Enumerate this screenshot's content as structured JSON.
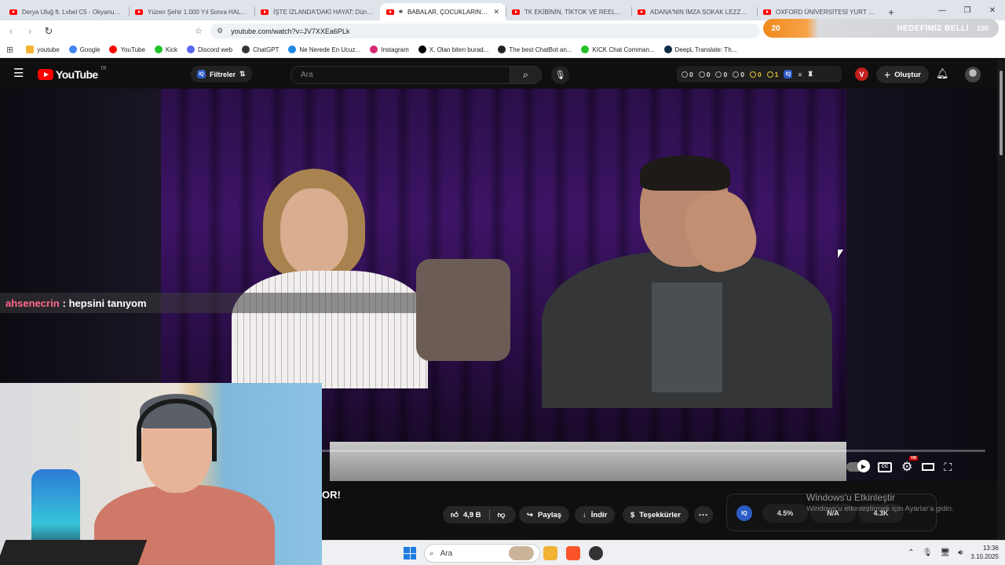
{
  "browser": {
    "tabs": [
      {
        "title": "Derya Uluğ ft. Lvbel C5 - Okyanus X",
        "active": false
      },
      {
        "title": "Yüzen Şehir 1.000 Yıl Sonra HALA N",
        "active": false
      },
      {
        "title": "İŞTE İZLANDA'DAKİ HAYAT: Dünyan",
        "active": false
      },
      {
        "title": "BABALAR, ÇOCUKLARININ T",
        "active": true
      },
      {
        "title": "TK EKİBİNİN, TİKTOK VE REELS VİDEO",
        "active": false
      },
      {
        "title": "ADANA'NIN İMZA SOKAK LEZZETLER",
        "active": false
      },
      {
        "title": "OXFORD ÜNİVERSİTESİ YURT ODASI",
        "active": false
      }
    ],
    "url": "youtube.com/watch?v=JV7XXEa6PLk",
    "promo": {
      "left_num": "20",
      "title": "HEDEFİMİZ BELLİ",
      "right_num": "100"
    },
    "bookmarks": [
      {
        "label": "youtube",
        "icon": "folder-icon",
        "color": "#f2b233"
      },
      {
        "label": "Google",
        "icon": "google-icon",
        "color": "#4285f4"
      },
      {
        "label": "YouTube",
        "icon": "youtube-icon",
        "color": "#ff0000"
      },
      {
        "label": "Kick",
        "icon": "kick-icon",
        "color": "#23c22a"
      },
      {
        "label": "Discord web",
        "icon": "discord-icon",
        "color": "#5865f2"
      },
      {
        "label": "ChatGPT",
        "icon": "chatgpt-icon",
        "color": "#333333"
      },
      {
        "label": "Ne Nerede En Ucuz...",
        "icon": "check-icon",
        "color": "#1e88e5"
      },
      {
        "label": "Instagram",
        "icon": "instagram-icon",
        "color": "#d62976"
      },
      {
        "label": "X. Olan biten burad...",
        "icon": "x-icon",
        "color": "#000000"
      },
      {
        "label": "The best ChatBot an...",
        "icon": "github-icon",
        "color": "#222222"
      },
      {
        "label": "KICK Chat Comman...",
        "icon": "kick-icon",
        "color": "#23c22a"
      },
      {
        "label": "DeepL Translate: Th...",
        "icon": "deepl-icon",
        "color": "#0f2b46"
      }
    ]
  },
  "youtube": {
    "logo": "YouTube",
    "region": "TR",
    "filters_label": "Filtreler",
    "search_placeholder": "Ara",
    "stats": [
      {
        "value": "0",
        "style": "normal"
      },
      {
        "value": "0",
        "style": "normal"
      },
      {
        "value": "0",
        "style": "normal"
      },
      {
        "value": "0",
        "style": "normal"
      },
      {
        "value": "0",
        "style": "yellow"
      },
      {
        "value": "1",
        "style": "yellow"
      }
    ],
    "v_badge": "V",
    "create_label": "Oluştur",
    "chat": {
      "user": "ahsenecrin",
      "message": ": hepsini tanıyom"
    },
    "video_title_visible": "OR!",
    "actions": {
      "likes": "4,9 B",
      "share": "Paylaş",
      "download": "İndir",
      "thanks": "Teşekkürler",
      "more": "···"
    },
    "iq_panel": {
      "logo": "IQ",
      "values": [
        "4.5%",
        "N/A",
        "4.3K"
      ]
    },
    "activation_title": "Windows'u Etkinleştir",
    "activation_sub": "Windows'u etkinleştirmek için Ayarlar'a gidin.",
    "hd_badge": "HD"
  },
  "taskbar": {
    "search_placeholder": "Ara",
    "time": "13:36",
    "date": "3.10.2025"
  }
}
